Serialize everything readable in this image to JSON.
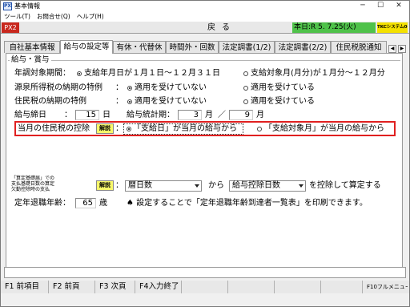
{
  "window": {
    "title": "基本情報",
    "icon": "PX",
    "minimize": "─",
    "maximize": "☐",
    "close": "✕"
  },
  "menubar": {
    "items": [
      "ツール(T)",
      "お問合せ(Q)",
      "ヘルプ(H)"
    ]
  },
  "header": {
    "mode": "PX2",
    "back": "戻る",
    "date": "本日:R 5. 7.25(火)",
    "brand": "TKCシステム06&A"
  },
  "tabs": {
    "items": [
      "自社基本情報",
      "給与の設定等",
      "有休・代替休",
      "時間外・回数",
      "法定調書(1/2)",
      "法定調書(2/2)",
      "住民税脱通知"
    ],
    "active_index": 1,
    "prev_arrow": "◀",
    "next_arrow": "▶"
  },
  "group": {
    "title": "給与・賞与"
  },
  "rows": {
    "year_period": {
      "label": "年調対象期間：",
      "opt1": "支給年月日が１月１日〜１２月３１日",
      "opt2": "支給対象月(月分)が１月分〜１２月分",
      "selected": "opt1"
    },
    "withholding_special": {
      "label": "源泉所得税の納期の特例",
      "colon": "：",
      "opt1": "適用を受けていない",
      "opt2": "適用を受けている",
      "selected": "opt1"
    },
    "resident_special": {
      "label": "住民税の納期の特例",
      "colon": "：",
      "opt1": "適用を受けていない",
      "opt2": "適用を受けている",
      "selected": "opt1"
    },
    "closing": {
      "label": "給与締日",
      "colon": "：",
      "day": "15",
      "day_unit": "日",
      "stat_label": "給与統計期：",
      "from_month": "3",
      "month_unit": "月",
      "slash": "／",
      "to_month": "9",
      "month_unit2": "月"
    },
    "current_month_deduction": {
      "label": "当月の住民税の控除",
      "explain": "解説",
      "colon": "：",
      "opt1": "「支給日」が当月の給与から",
      "opt2": "「支給対象月」が当月の給与から",
      "selected": "opt1"
    },
    "base_days": {
      "label_small": [
        "「算定基礎届」での",
        "支払基礎日数の算定",
        "欠勤控除時の支払"
      ],
      "explain": "解説",
      "colon": "：",
      "combo1": "暦日数",
      "from": "から",
      "combo2": "給与控除日数",
      "suffix": "を控除して算定する"
    },
    "retirement": {
      "label": "定年退職年齢：",
      "age": "65",
      "unit": "歳",
      "note": "♠ 設定することで「定年退職年齢到達者一覧表」を印刷できます。"
    }
  },
  "fkeys": {
    "f1": "F1 前項目",
    "f2": "F2 前頁",
    "f3": "F3 次頁",
    "f4": "F4入力終了",
    "f10": "F10フルメニュー"
  }
}
